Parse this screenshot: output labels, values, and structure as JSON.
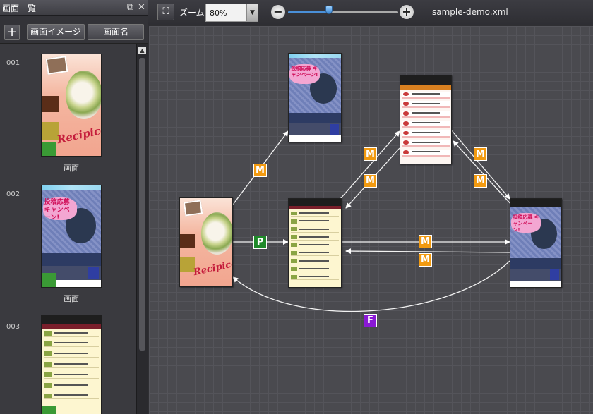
{
  "panel": {
    "title": "画面一覧",
    "btn_image": "画面イメージ",
    "btn_name": "画面名"
  },
  "screens": [
    {
      "num": "001",
      "caption": "画面",
      "kind": "recipe"
    },
    {
      "num": "002",
      "caption": "画面",
      "kind": "campaign"
    },
    {
      "num": "003",
      "caption": "",
      "kind": "list"
    }
  ],
  "toolbar": {
    "zoom_label": "ズーム",
    "zoom_value": "80%",
    "zoom_level_percent": 80,
    "filename": "sample-demo.xml"
  },
  "canvas": {
    "logo_text": "Recipico",
    "campaign_text": "投稿応募 キャンペーン!",
    "transitions": [
      {
        "label": "M",
        "color": "#f29a10"
      },
      {
        "label": "P",
        "color": "#1f8a2a"
      },
      {
        "label": "M",
        "color": "#f29a10"
      },
      {
        "label": "M",
        "color": "#f29a10"
      },
      {
        "label": "M",
        "color": "#f29a10"
      },
      {
        "label": "M",
        "color": "#f29a10"
      },
      {
        "label": "M",
        "color": "#f29a10"
      },
      {
        "label": "M",
        "color": "#f29a10"
      },
      {
        "label": "F",
        "color": "#8a18d6"
      }
    ]
  },
  "icons": {
    "add": "plus-icon",
    "restore": "restore-window-icon",
    "close": "close-icon",
    "fit": "fit-to-screen-icon",
    "zoom_out": "zoom-out-icon",
    "zoom_in": "zoom-in-icon",
    "scroll_top": "scroll-top-icon"
  }
}
